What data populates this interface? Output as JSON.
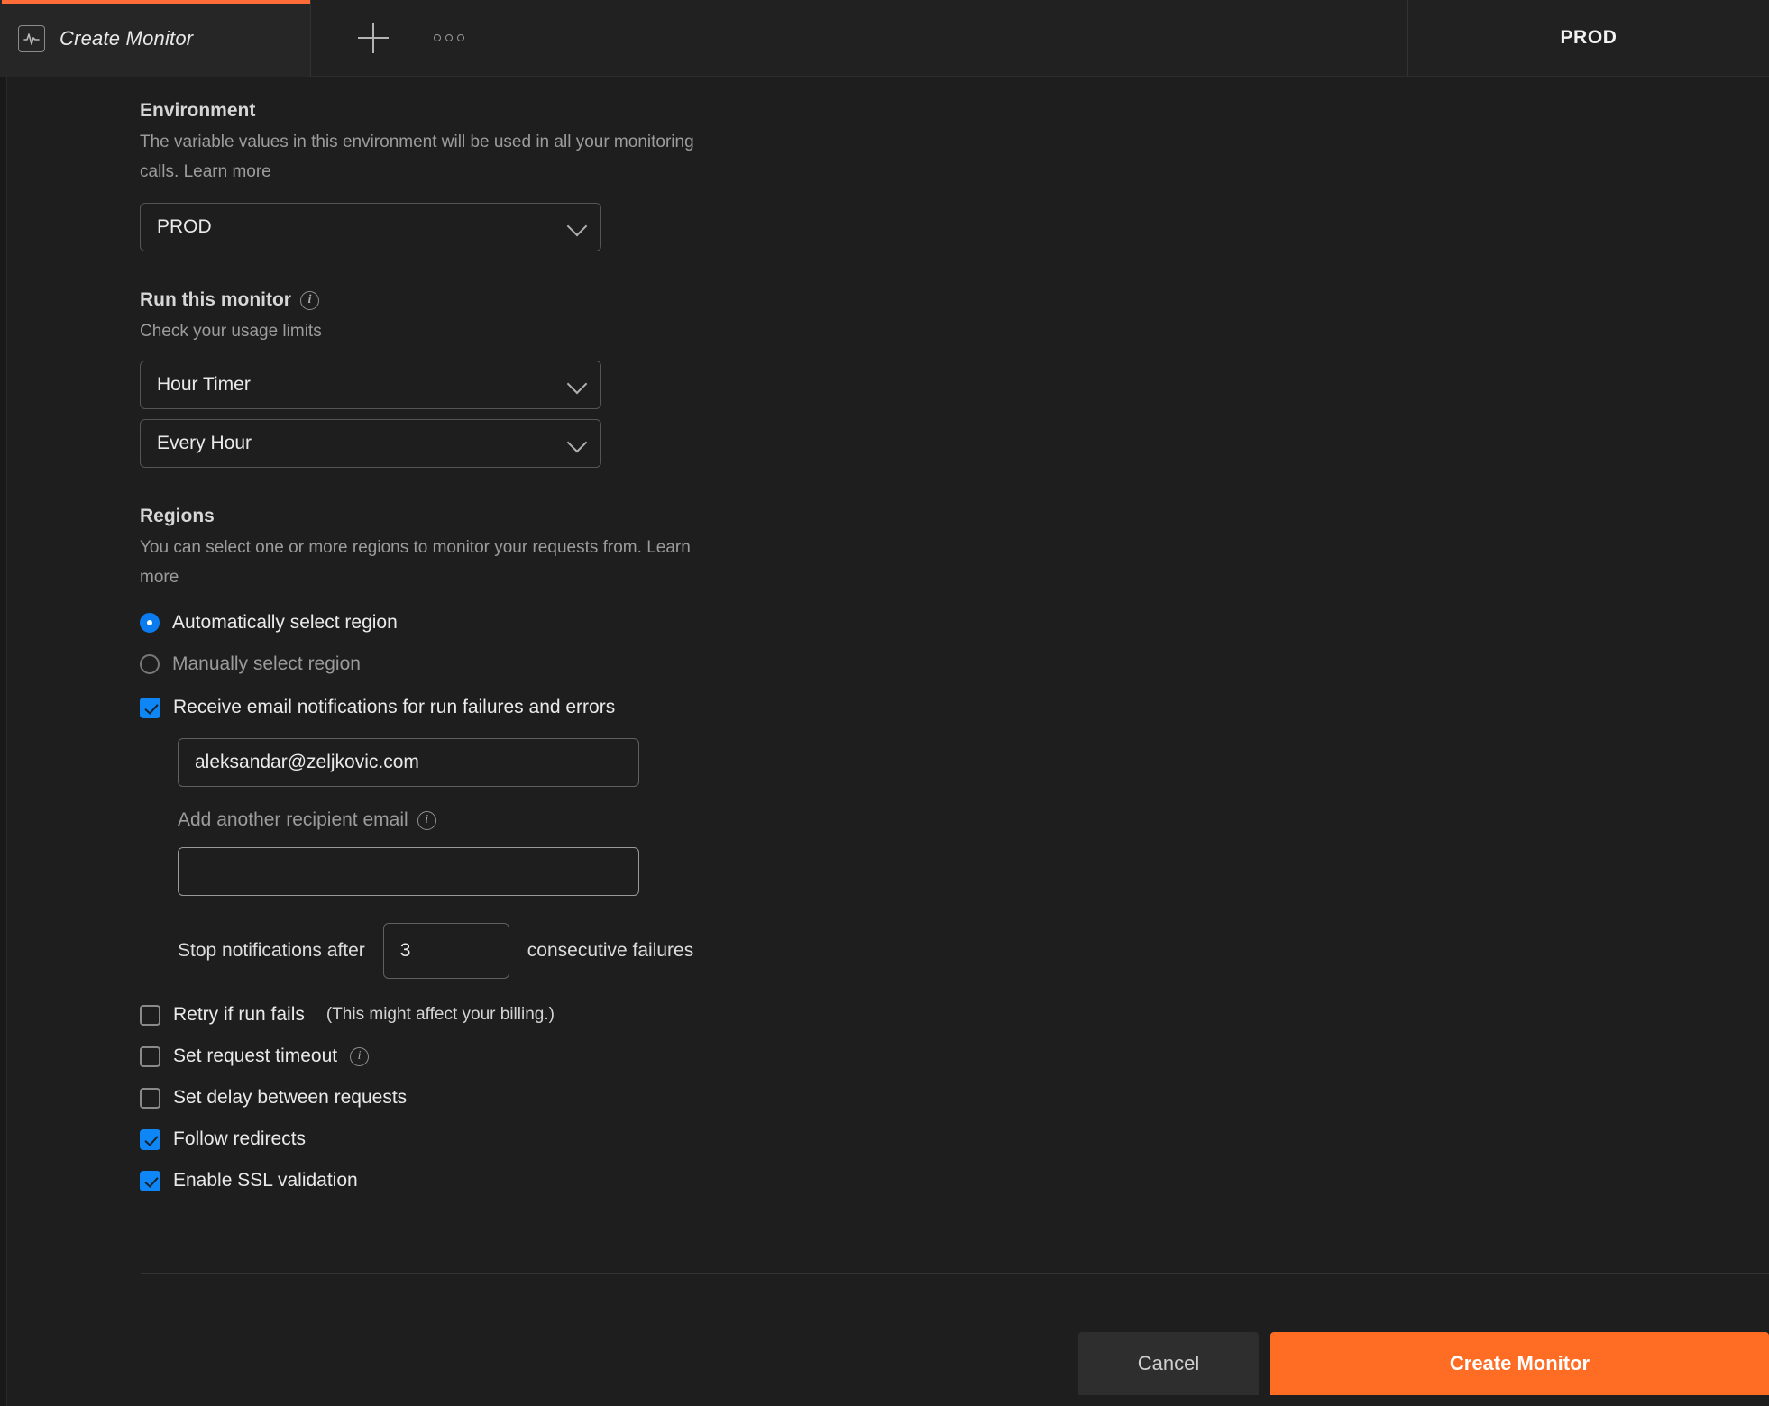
{
  "tabbar": {
    "active_tab_label": "Create Monitor",
    "active_tab_icon": "monitor-pulse-icon",
    "new_tab_icon": "plus-icon",
    "more_icon": "more-horizontal-icon",
    "environment_badge": "PROD",
    "accent_color": "#ff6c37"
  },
  "environment": {
    "title": "Environment",
    "description": "The variable values in this environment will be used in all your monitoring calls. Learn more",
    "selected": "PROD"
  },
  "schedule": {
    "title": "Run this monitor",
    "info_icon": "info-icon",
    "description": "Check your usage limits",
    "timer_selected": "Hour Timer",
    "frequency_selected": "Every Hour"
  },
  "regions": {
    "title": "Regions",
    "description": "You can select one or more regions to monitor your requests from. Learn more",
    "options": [
      {
        "label": "Automatically select region",
        "selected": true
      },
      {
        "label": "Manually select region",
        "selected": false
      }
    ],
    "radio_color": "#0a7cf0"
  },
  "notifications": {
    "email_checkbox_label": "Receive email notifications for run failures and errors",
    "email_checked": true,
    "email_value": "aleksandar@zeljkovic.com",
    "add_recipient_label": "Add another recipient email",
    "add_recipient_info_icon": "info-icon",
    "add_recipient_value": "",
    "stop_prefix": "Stop notifications after",
    "stop_value": "3",
    "stop_suffix": "consecutive failures",
    "checkbox_color": "#0f86f5"
  },
  "options": [
    {
      "label": "Retry if run fails",
      "note": "(This might affect your billing.)",
      "checked": false,
      "info": false
    },
    {
      "label": "Set request timeout",
      "note": "",
      "checked": false,
      "info": true
    },
    {
      "label": "Set delay between requests",
      "note": "",
      "checked": false,
      "info": false
    },
    {
      "label": "Follow redirects",
      "note": "",
      "checked": true,
      "info": false
    },
    {
      "label": "Enable SSL validation",
      "note": "",
      "checked": true,
      "info": false
    }
  ],
  "footer": {
    "cancel_label": "Cancel",
    "primary_label": "Create Monitor",
    "primary_color": "#ff6c24"
  }
}
